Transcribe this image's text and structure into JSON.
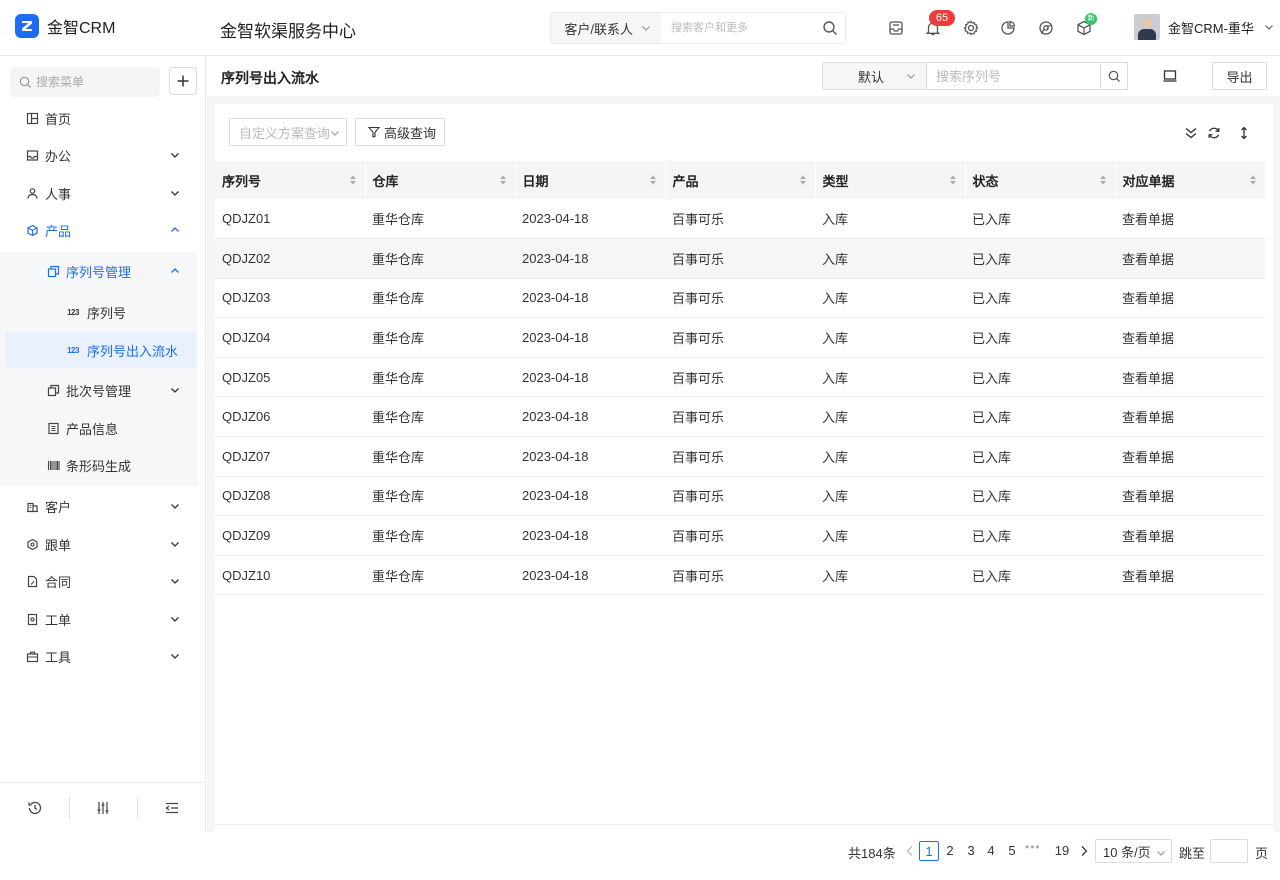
{
  "app": {
    "logo_text": "金智CRM",
    "title": "金智软渠服务中心"
  },
  "global_search": {
    "scope": "客户/联系人",
    "placeholder": "搜索客户和更多"
  },
  "topbar": {
    "notification_count": "65",
    "new_badge": "新",
    "user_name": "金智CRM-重华"
  },
  "sidebar": {
    "search_placeholder": "搜索菜单",
    "items": [
      {
        "label": "首页",
        "icon": "grid-icon"
      },
      {
        "label": "办公",
        "icon": "inbox-icon"
      },
      {
        "label": "人事",
        "icon": "people-icon"
      },
      {
        "label": "产品",
        "icon": "cube-icon"
      },
      {
        "label": "序列号管理",
        "icon": "copy-icon"
      },
      {
        "label": "序列号",
        "icon": "numbers-icon"
      },
      {
        "label": "序列号出入流水",
        "icon": "numbers-icon"
      },
      {
        "label": "批次号管理",
        "icon": "copy-icon"
      },
      {
        "label": "产品信息",
        "icon": "list-icon"
      },
      {
        "label": "条形码生成",
        "icon": "barcode-icon"
      },
      {
        "label": "客户",
        "icon": "building-icon"
      },
      {
        "label": "跟单",
        "icon": "target-icon"
      },
      {
        "label": "合同",
        "icon": "contract-icon"
      },
      {
        "label": "工单",
        "icon": "ticket-icon"
      },
      {
        "label": "工具",
        "icon": "toolbox-icon"
      }
    ]
  },
  "page": {
    "title": "序列号出入流水",
    "filter_default": "默认",
    "search_placeholder": "搜索序列号",
    "export_label": "导出",
    "custom_query_placeholder": "自定义方案查询",
    "advanced_query_label": "高级查询"
  },
  "table": {
    "columns": [
      "序列号",
      "仓库",
      "日期",
      "产品",
      "类型",
      "状态",
      "对应单据"
    ],
    "rows": [
      {
        "serial": "QDJZ01",
        "warehouse": "重华仓库",
        "date": "2023-04-18",
        "product": "百事可乐",
        "type": "入库",
        "status": "已入库",
        "doc": "查看单据"
      },
      {
        "serial": "QDJZ02",
        "warehouse": "重华仓库",
        "date": "2023-04-18",
        "product": "百事可乐",
        "type": "入库",
        "status": "已入库",
        "doc": "查看单据"
      },
      {
        "serial": "QDJZ03",
        "warehouse": "重华仓库",
        "date": "2023-04-18",
        "product": "百事可乐",
        "type": "入库",
        "status": "已入库",
        "doc": "查看单据"
      },
      {
        "serial": "QDJZ04",
        "warehouse": "重华仓库",
        "date": "2023-04-18",
        "product": "百事可乐",
        "type": "入库",
        "status": "已入库",
        "doc": "查看单据"
      },
      {
        "serial": "QDJZ05",
        "warehouse": "重华仓库",
        "date": "2023-04-18",
        "product": "百事可乐",
        "type": "入库",
        "status": "已入库",
        "doc": "查看单据"
      },
      {
        "serial": "QDJZ06",
        "warehouse": "重华仓库",
        "date": "2023-04-18",
        "product": "百事可乐",
        "type": "入库",
        "status": "已入库",
        "doc": "查看单据"
      },
      {
        "serial": "QDJZ07",
        "warehouse": "重华仓库",
        "date": "2023-04-18",
        "product": "百事可乐",
        "type": "入库",
        "status": "已入库",
        "doc": "查看单据"
      },
      {
        "serial": "QDJZ08",
        "warehouse": "重华仓库",
        "date": "2023-04-18",
        "product": "百事可乐",
        "type": "入库",
        "status": "已入库",
        "doc": "查看单据"
      },
      {
        "serial": "QDJZ09",
        "warehouse": "重华仓库",
        "date": "2023-04-18",
        "product": "百事可乐",
        "type": "入库",
        "status": "已入库",
        "doc": "查看单据"
      },
      {
        "serial": "QDJZ10",
        "warehouse": "重华仓库",
        "date": "2023-04-18",
        "product": "百事可乐",
        "type": "入库",
        "status": "已入库",
        "doc": "查看单据"
      }
    ]
  },
  "pagination": {
    "total": "共184条",
    "pages": [
      "1",
      "2",
      "3",
      "4",
      "5"
    ],
    "ellipsis": "•••",
    "last_page": "19",
    "page_size": "10 条/页",
    "jump_label": "跳至",
    "page_suffix": "页"
  },
  "colors": {
    "accent": "#1e6cf2",
    "badge_red": "#ef3b3b",
    "badge_green": "#35c56e"
  }
}
